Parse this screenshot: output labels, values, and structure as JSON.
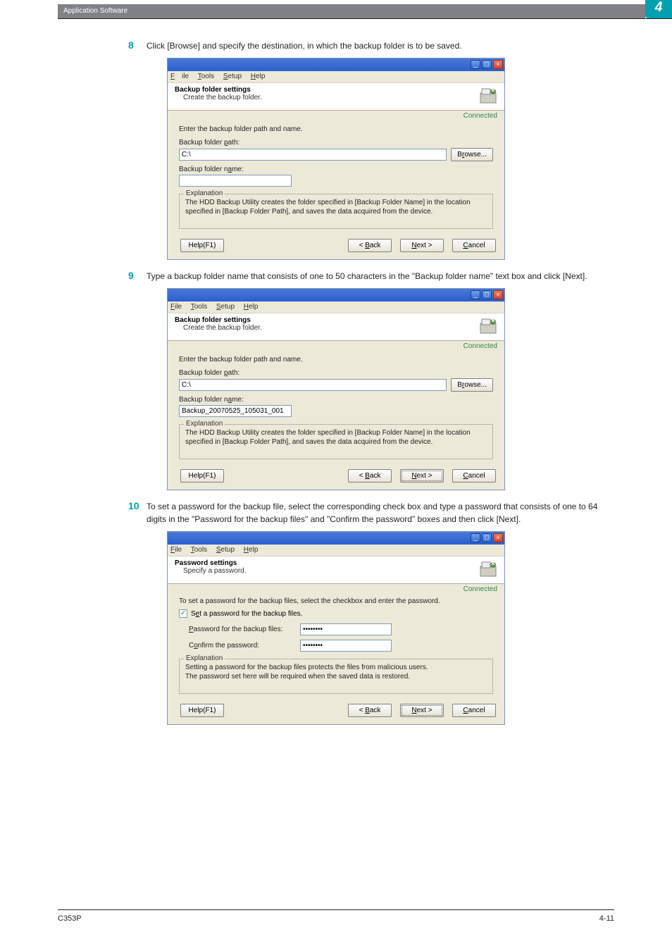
{
  "header": {
    "section_title": "Application Software",
    "chapter_number": "4"
  },
  "footer": {
    "model": "C353P",
    "page": "4-11"
  },
  "steps": {
    "s8": {
      "num": "8",
      "text": "Click [Browse] and specify the destination, in which the backup folder is to be saved."
    },
    "s9": {
      "num": "9",
      "text": "Type a backup folder name that consists of one to 50 characters in the \"Backup folder name\" text box and click [Next]."
    },
    "s10": {
      "num": "10",
      "text": "To set a password for the backup file, select the corresponding check box and type a password that consists of one to 64 digits in the \"Password for the backup files\" and \"Confirm the password\" boxes and then click [Next]."
    }
  },
  "menubar": {
    "file": "File",
    "tools": "Tools",
    "setup": "Setup",
    "help": "Help"
  },
  "common": {
    "connected": "Connected",
    "explanation_legend": "Explanation",
    "help_btn": "Help(F1)",
    "back_btn": "< Back",
    "next_btn": "Next >",
    "cancel_btn": "Cancel",
    "browse_btn": "Browse..."
  },
  "dlg1": {
    "banner_title": "Backup folder settings",
    "banner_sub": "Create the backup folder.",
    "prompt": "Enter the backup folder path and name.",
    "path_label": "Backup folder path:",
    "path_value": "C:\\",
    "name_label": "Backup folder name:",
    "name_value": "",
    "expl": "The HDD Backup Utility creates the folder specified in [Backup Folder Name] in the location specified in [Backup Folder Path], and saves the data acquired from the device."
  },
  "dlg2": {
    "banner_title": "Backup folder settings",
    "banner_sub": "Create the backup folder.",
    "prompt": "Enter the backup folder path and name.",
    "path_label": "Backup folder path:",
    "path_value": "C:\\",
    "name_label": "Backup folder name:",
    "name_value": "Backup_20070525_105031_001",
    "expl": "The HDD Backup Utility creates the folder specified in [Backup Folder Name] in the location specified in [Backup Folder Path], and saves the data acquired from the device."
  },
  "dlg3": {
    "banner_title": "Password settings",
    "banner_sub": "Specify a password.",
    "prompt": "To set a password for the backup files, select the checkbox and enter the password.",
    "chk_label": "Set a password for the backup files.",
    "pw_label": "Password for the backup files:",
    "pw_value": "********",
    "cf_label": "Confirm the password:",
    "cf_value": "********",
    "expl": "Setting a password for the backup files protects the files from malicious users.\nThe password set here will be required when the saved data is restored."
  }
}
